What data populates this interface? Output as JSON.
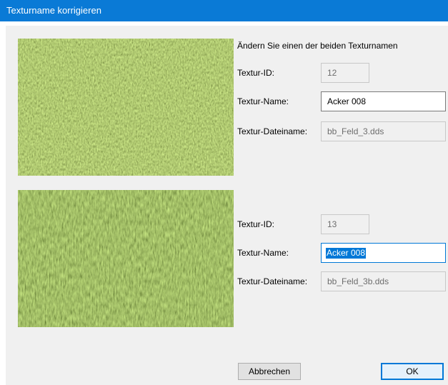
{
  "window": {
    "title": "Texturname korrigieren"
  },
  "instruction": "Ändern Sie einen der beiden Texturnamen",
  "textures": [
    {
      "id_label": "Textur-ID:",
      "id_value": "12",
      "name_label": "Textur-Name:",
      "name_value": "Acker 008",
      "file_label": "Textur-Dateiname:",
      "file_value": "bb_Feld_3.dds"
    },
    {
      "id_label": "Textur-ID:",
      "id_value": "13",
      "name_label": "Textur-Name:",
      "name_value": "Acker 008",
      "file_label": "Textur-Dateiname:",
      "file_value": "bb_Feld_3b.dds"
    }
  ],
  "buttons": {
    "cancel": "Abbrechen",
    "ok": "OK"
  },
  "colors": {
    "title_bar": "#0a7ad6",
    "dialog_bg": "#f0f0f0",
    "accent": "#0078d7"
  }
}
